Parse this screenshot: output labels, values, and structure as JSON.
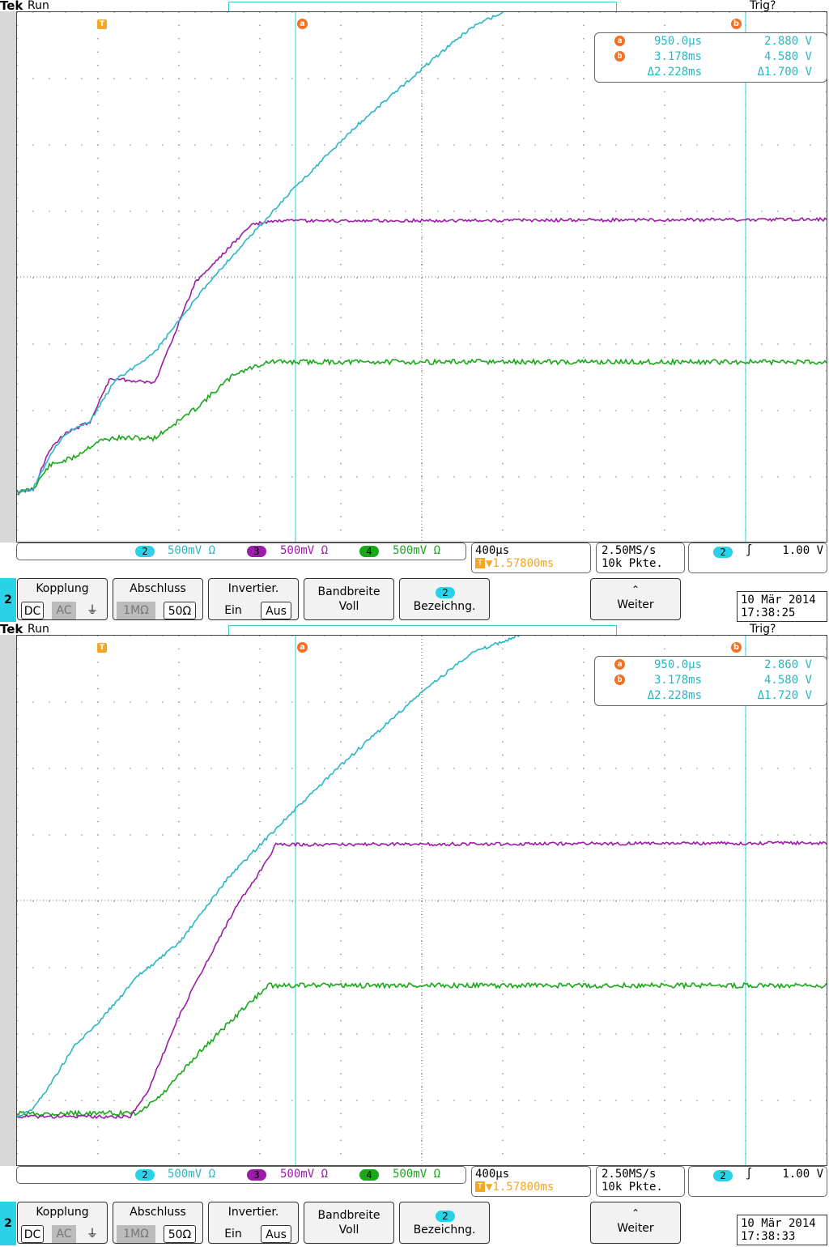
{
  "colors": {
    "ch2": "#29b6c6",
    "ch3": "#9b1ca7",
    "ch4": "#18a818",
    "marker": "#f36f21",
    "trigger_marker": "#f5a623",
    "menu_accent": "#29d2e6"
  },
  "scopes": [
    {
      "header": {
        "logo": "Tek",
        "run": "Run",
        "trig": "Trig?"
      },
      "markers": {
        "trigger": "T",
        "a": "a",
        "b": "b",
        "ch_ref": "2"
      },
      "cursors": {
        "a_time": "950.0µs",
        "a_volt": "2.880 V",
        "b_time": "3.178ms",
        "b_volt": "4.580 V",
        "delta_time": "Δ2.228ms",
        "delta_volt": "Δ1.700 V"
      },
      "channels": [
        {
          "num": "2",
          "scale": "500mV Ω"
        },
        {
          "num": "3",
          "scale": "500mV Ω"
        },
        {
          "num": "4",
          "scale": "500mV Ω"
        }
      ],
      "timebase": {
        "div": "400µs",
        "trigger_pos": "▼1.57800ms"
      },
      "sample": {
        "rate": "2.50MS/s",
        "points": "10k Pkte."
      },
      "trigger": {
        "source": "2",
        "slope": "∫",
        "level": "1.00 V"
      },
      "menu": {
        "channel": "2",
        "kopplung": "Kopplung",
        "dc": "DC",
        "ac": "AC",
        "gnd": "⏚",
        "abschluss": "Abschluss",
        "r1m": "1MΩ",
        "r50": "50Ω",
        "invertier": "Invertier.",
        "ein": "Ein",
        "aus": "Aus",
        "bandbreite": "Bandbreite",
        "voll": "Voll",
        "bezeichng_num": "2",
        "bezeichng": "Bezeichng.",
        "weiter": "Weiter"
      },
      "datetime": {
        "date": "10 Mär 2014",
        "time": "17:38:25"
      }
    },
    {
      "header": {
        "logo": "Tek",
        "run": "Run",
        "trig": "Trig?"
      },
      "markers": {
        "trigger": "T",
        "a": "a",
        "b": "b",
        "ch_ref": "2"
      },
      "cursors": {
        "a_time": "950.0µs",
        "a_volt": "2.860 V",
        "b_time": "3.178ms",
        "b_volt": "4.580 V",
        "delta_time": "Δ2.228ms",
        "delta_volt": "Δ1.720 V"
      },
      "channels": [
        {
          "num": "2",
          "scale": "500mV Ω"
        },
        {
          "num": "3",
          "scale": "500mV Ω"
        },
        {
          "num": "4",
          "scale": "500mV Ω"
        }
      ],
      "timebase": {
        "div": "400µs",
        "trigger_pos": "▼1.57800ms"
      },
      "sample": {
        "rate": "2.50MS/s",
        "points": "10k Pkte."
      },
      "trigger": {
        "source": "2",
        "slope": "∫",
        "level": "1.00 V"
      },
      "menu": {
        "channel": "2",
        "kopplung": "Kopplung",
        "dc": "DC",
        "ac": "AC",
        "gnd": "⏚",
        "abschluss": "Abschluss",
        "r1m": "1MΩ",
        "r50": "50Ω",
        "invertier": "Invertier.",
        "ein": "Ein",
        "aus": "Aus",
        "bandbreite": "Bandbreite",
        "voll": "Voll",
        "bezeichng_num": "2",
        "bezeichng": "Bezeichng.",
        "weiter": "Weiter"
      },
      "datetime": {
        "date": "10 Mär 2014",
        "time": "17:38:33"
      }
    }
  ]
}
